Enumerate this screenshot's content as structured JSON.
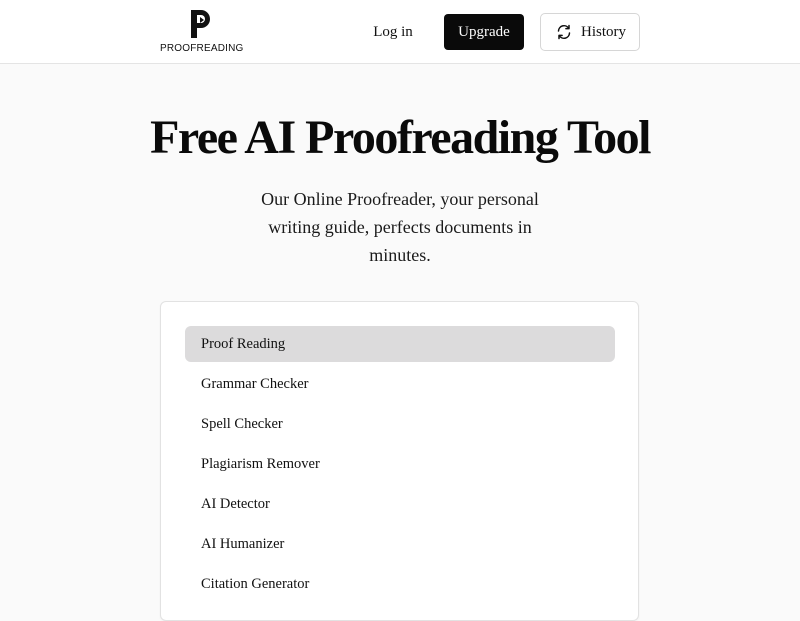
{
  "header": {
    "logo_text": "PROOFREADING",
    "login_label": "Log in",
    "upgrade_label": "Upgrade",
    "history_label": "History",
    "history_icon": "refresh-icon"
  },
  "hero": {
    "title": "Free AI Proofreading Tool",
    "subtitle": "Our Online Proofreader, your personal writing guide, perfects documents in minutes."
  },
  "tools": {
    "selected": "Proof Reading",
    "items": [
      {
        "label": "Proof Reading"
      },
      {
        "label": "Grammar Checker"
      },
      {
        "label": "Spell Checker"
      },
      {
        "label": "Plagiarism Remover"
      },
      {
        "label": "AI Detector"
      },
      {
        "label": "AI Humanizer"
      },
      {
        "label": "Citation Generator"
      }
    ]
  },
  "colors": {
    "accent": "#0a0a0a",
    "selected_bg": "#dcdbdc",
    "page_bg": "#fafafa"
  }
}
